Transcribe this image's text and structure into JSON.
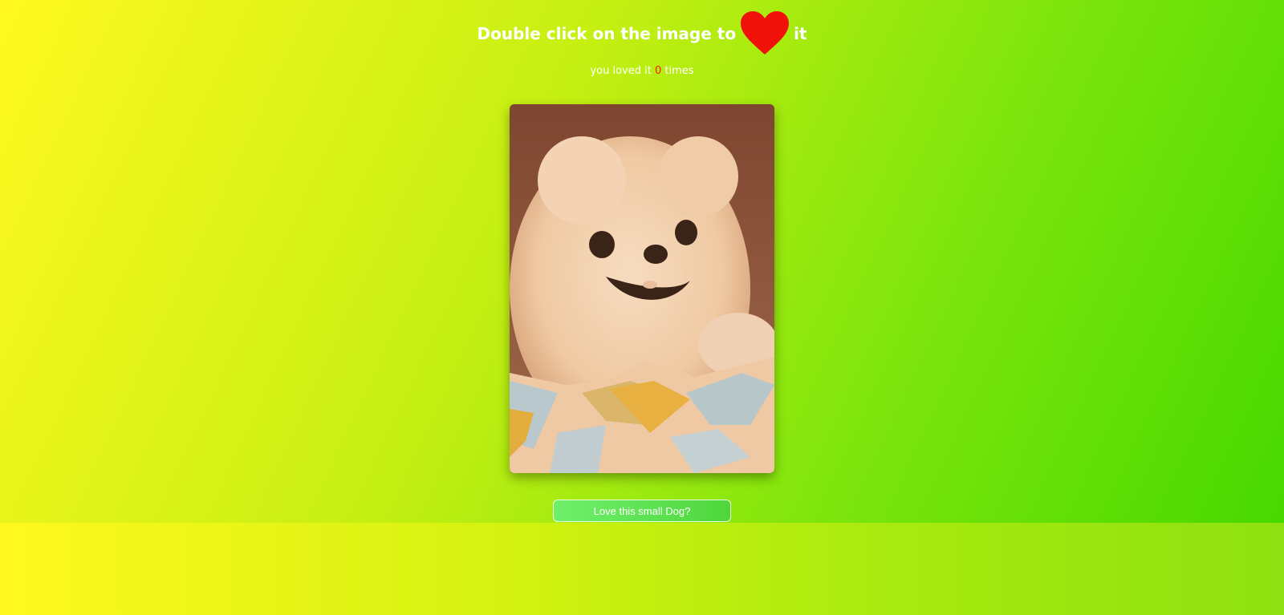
{
  "header": {
    "title_prefix": "Double click on the image to",
    "title_suffix": "it",
    "heart_icon": "heart-icon",
    "heart_color": "#f01208"
  },
  "counter": {
    "prefix": "you loved it",
    "count": "0",
    "suffix": "times",
    "count_color": "#ff1a00"
  },
  "photo": {
    "subject": "pomeranian-dog-photo"
  },
  "button": {
    "label": "Love this small Dog?"
  },
  "colors": {
    "background_start": "#fff81f",
    "background_end": "#47d900",
    "text": "#ffffff"
  }
}
